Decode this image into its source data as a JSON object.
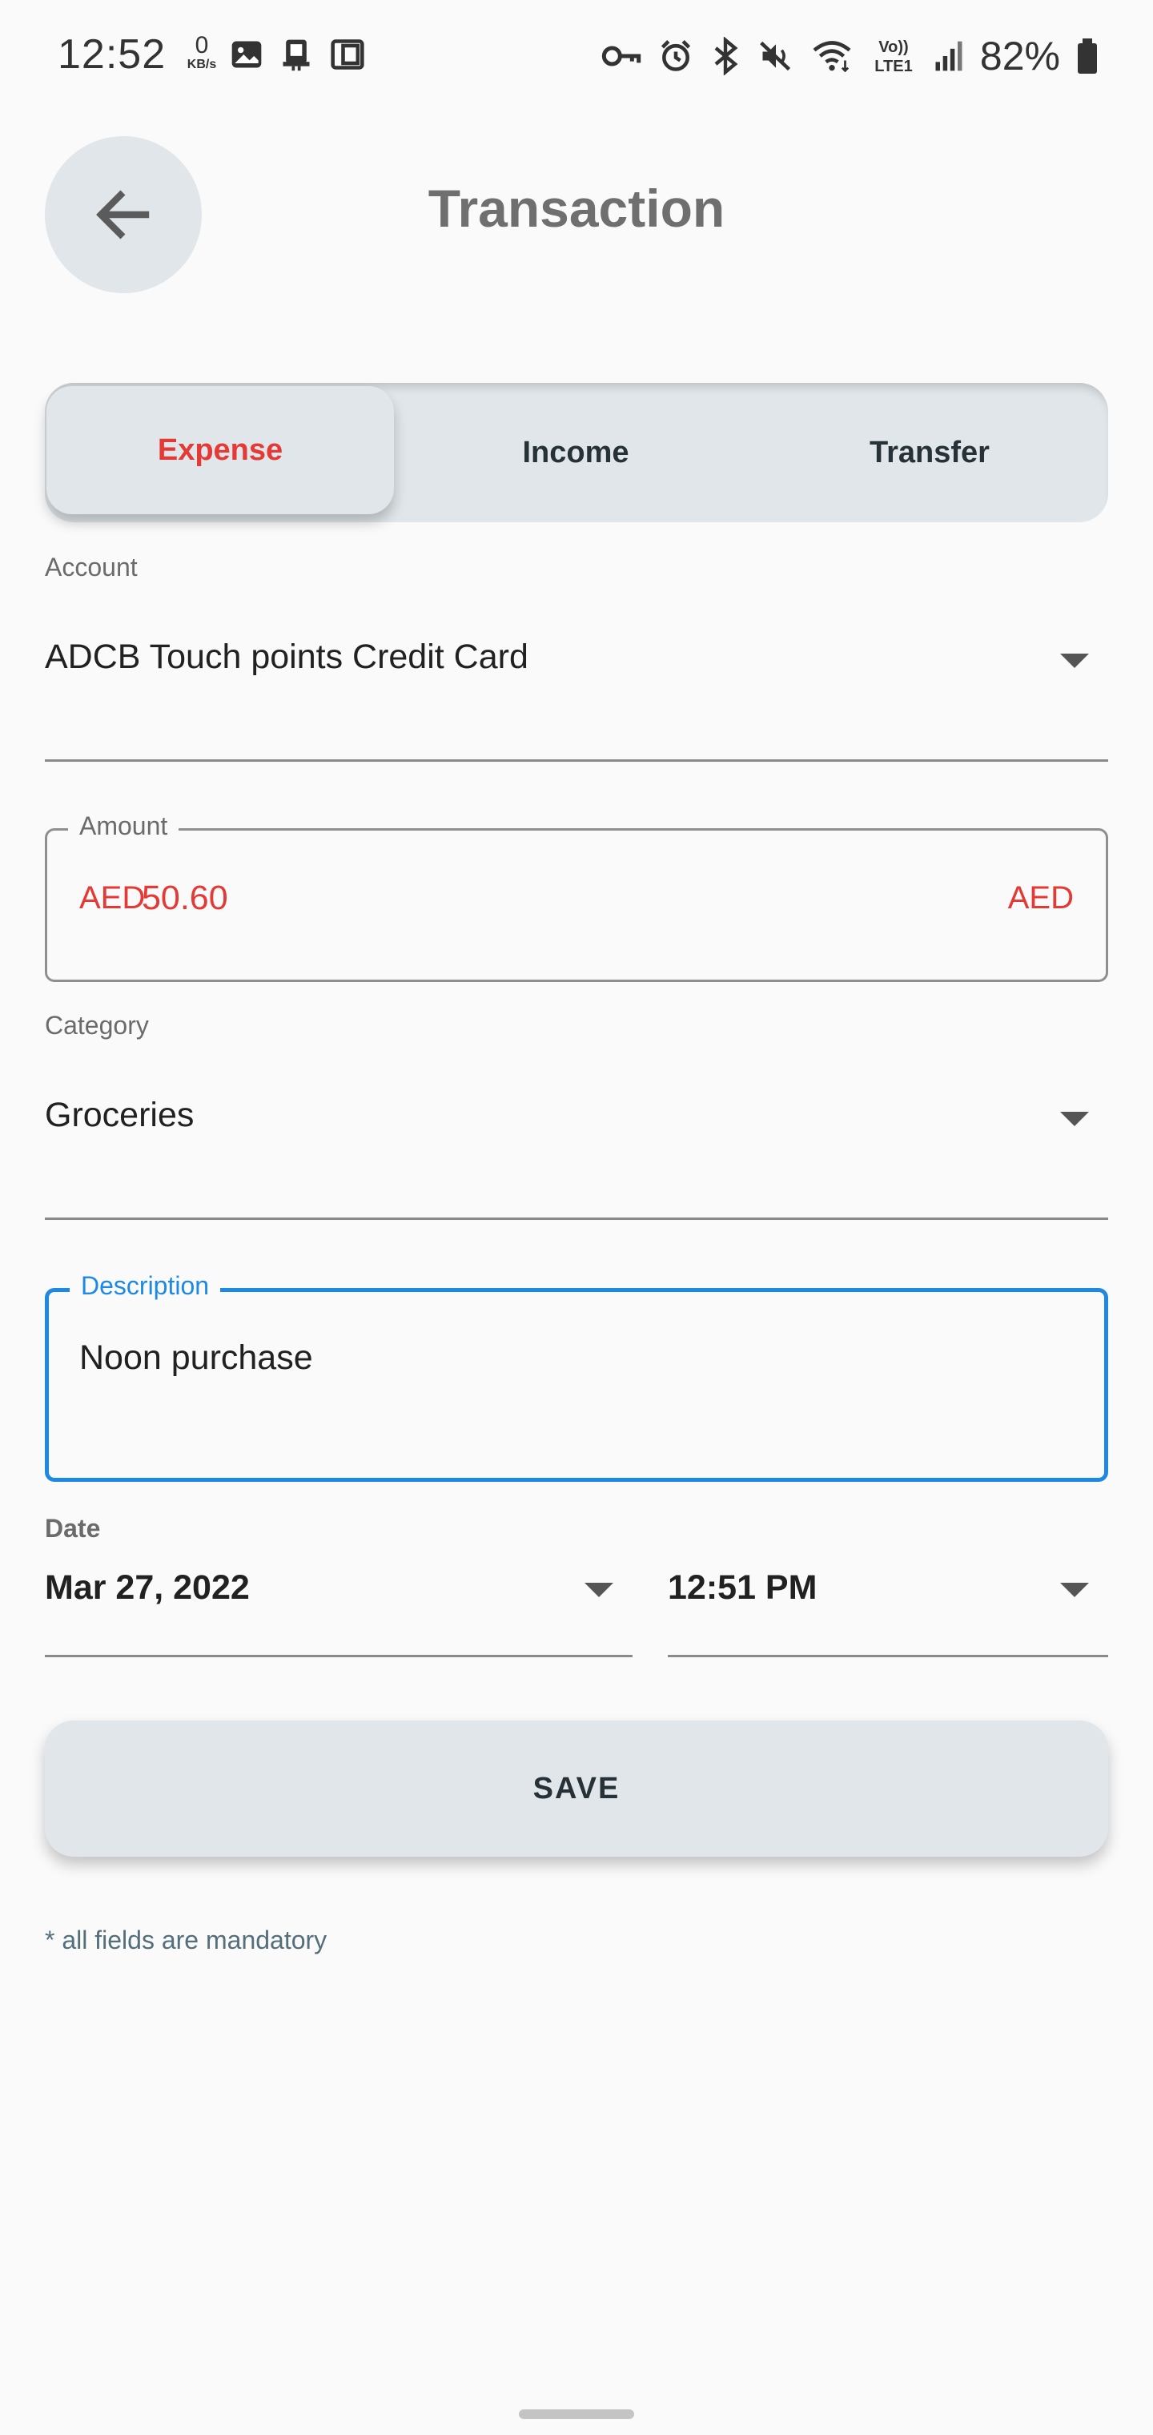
{
  "status_bar": {
    "time": "12:52",
    "net_speed_value": "0",
    "net_speed_unit": "KB/s",
    "battery": "82%",
    "icons_left": [
      "gallery-icon",
      "phone-icon",
      "wallet-icon"
    ],
    "icons_right": [
      "key-icon",
      "alarm-icon",
      "bluetooth-icon",
      "mute-icon",
      "wifi-icon",
      "volte-icon",
      "signal-icon",
      "battery-icon"
    ],
    "volte_top": "Vo))",
    "volte_bottom": "LTE1"
  },
  "header": {
    "title": "Transaction",
    "back_icon": "arrow-left-icon"
  },
  "tabs": [
    {
      "label": "Expense",
      "active": true
    },
    {
      "label": "Income",
      "active": false
    },
    {
      "label": "Transfer",
      "active": false
    }
  ],
  "form": {
    "account": {
      "label": "Account",
      "value": "ADCB Touch points Credit Card"
    },
    "amount": {
      "label": "Amount",
      "prefix": "AED",
      "value": "50.60",
      "suffix": "AED"
    },
    "category": {
      "label": "Category",
      "value": "Groceries"
    },
    "description": {
      "label": "Description",
      "value": "Noon purchase"
    },
    "date": {
      "label": "Date",
      "value": "Mar 27, 2022"
    },
    "time": {
      "value": "12:51 PM"
    }
  },
  "save_label": "SAVE",
  "footnote": "* all fields are mandatory",
  "colors": {
    "accent": "#e53935",
    "focus": "#1e88e5",
    "surface": "#e0e6e9",
    "background": "#fafafa"
  }
}
